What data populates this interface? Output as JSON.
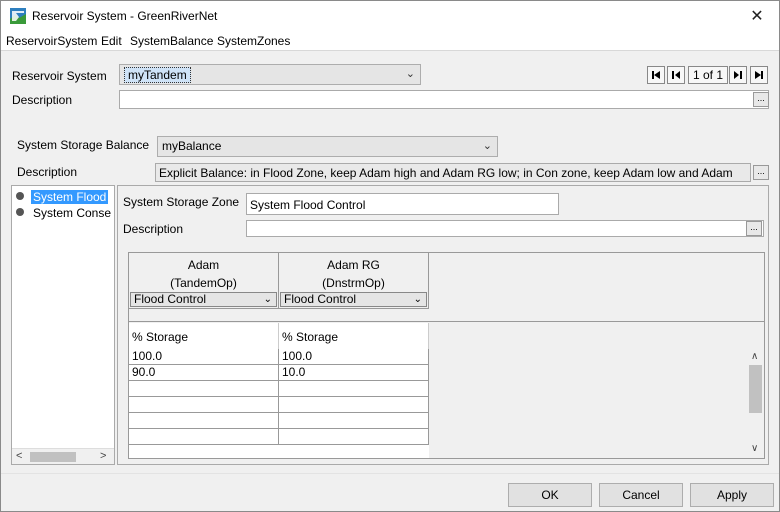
{
  "window": {
    "title": "Reservoir System - GreenRiverNet",
    "icon": "greenrivernet-app-icon",
    "close_label": "✕"
  },
  "menu": [
    "ReservoirSystem",
    "Edit",
    "SystemBalance",
    "SystemZones"
  ],
  "reservoir_system": {
    "label": "Reservoir System",
    "value": "myTandem",
    "description_label": "Description",
    "description_value": ""
  },
  "navigator": {
    "first_icon": "first-record-icon",
    "prev_icon": "previous-record-icon",
    "count": "1 of 1",
    "next_icon": "next-record-icon",
    "last_icon": "last-record-icon"
  },
  "balance": {
    "label": "System Storage Balance",
    "value": "myBalance",
    "description_label": "Description",
    "description_value": "Explicit Balance: in Flood Zone, keep Adam high and Adam RG low; in Con zone, keep Adam low and Adam"
  },
  "tree": {
    "items": [
      {
        "label": "System Flood",
        "selected": true
      },
      {
        "label": "System Conse",
        "selected": false
      }
    ]
  },
  "zone": {
    "label": "System Storage Zone",
    "value": "System Flood Control",
    "description_label": "Description",
    "description_value": ""
  },
  "table": {
    "columns": [
      {
        "name": "Adam",
        "method": "(TandemOp)",
        "zone": "Flood Control",
        "subheader": "% Storage"
      },
      {
        "name": "Adam RG",
        "method": "(DnstrmOp)",
        "zone": "Flood Control",
        "subheader": "% Storage"
      }
    ],
    "rows": [
      [
        "100.0",
        "100.0"
      ],
      [
        "90.0",
        "10.0"
      ],
      [
        "",
        ""
      ],
      [
        "",
        ""
      ],
      [
        "",
        ""
      ],
      [
        "",
        ""
      ]
    ]
  },
  "buttons": {
    "ok": "OK",
    "cancel": "Cancel",
    "apply": "Apply"
  },
  "ellipsis": "...",
  "colors": {
    "selection": "#3399ff",
    "title_bg": "#ffffff",
    "window_bg": "#f0f0f0"
  }
}
